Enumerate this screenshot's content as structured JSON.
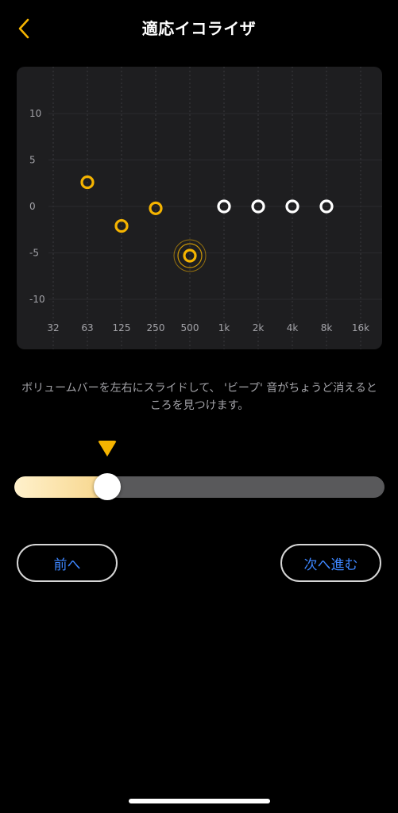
{
  "header": {
    "title": "適応イコライザ",
    "back_icon": "chevron-left-icon",
    "accent_color": "#f5b400"
  },
  "graph": {
    "y_ticks": [
      "10",
      "5",
      "0",
      "-5",
      "-10"
    ],
    "x_ticks": [
      "32",
      "63",
      "125",
      "250",
      "500",
      "1k",
      "2k",
      "4k",
      "8k",
      "16k"
    ]
  },
  "chart_data": {
    "type": "scatter",
    "x_categories": [
      "32",
      "63",
      "125",
      "250",
      "500",
      "1k",
      "2k",
      "4k",
      "8k",
      "16k"
    ],
    "ylim": [
      -10,
      10
    ],
    "points": [
      {
        "x": "63",
        "y": 2.6,
        "status": "set"
      },
      {
        "x": "125",
        "y": -2.1,
        "status": "set"
      },
      {
        "x": "250",
        "y": -0.2,
        "status": "set"
      },
      {
        "x": "500",
        "y": -5.3,
        "status": "active"
      },
      {
        "x": "1k",
        "y": 0,
        "status": "pending"
      },
      {
        "x": "2k",
        "y": 0,
        "status": "pending"
      },
      {
        "x": "4k",
        "y": 0,
        "status": "pending"
      },
      {
        "x": "8k",
        "y": 0,
        "status": "pending"
      }
    ],
    "colors": {
      "set": "#f5b400",
      "pending": "#ffffff"
    }
  },
  "instruction": {
    "text": "ボリュームバーを左右にスライドして、 'ビープ' 音がちょうど消えるところを見つけます。"
  },
  "slider": {
    "value_fraction": 0.25,
    "marker_fraction": 0.25
  },
  "buttons": {
    "prev_label": "前へ",
    "next_label": "次へ進む",
    "label_color": "#3d86ff"
  }
}
